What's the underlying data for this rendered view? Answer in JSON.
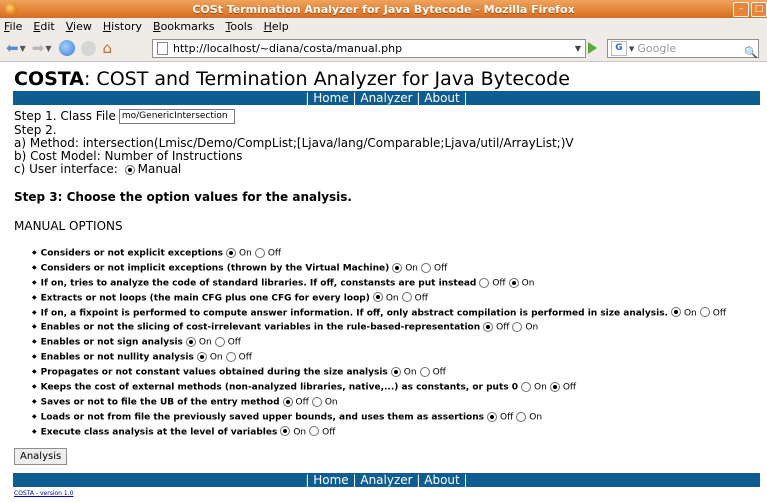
{
  "window": {
    "title": "COSt Termination Analyzer for Java Bytecode - Mozilla Firefox"
  },
  "menu": [
    "File",
    "Edit",
    "View",
    "History",
    "Bookmarks",
    "Tools",
    "Help"
  ],
  "nav": {
    "url": "http://localhost/~diana/costa/manual.php",
    "search_placeholder": "Google"
  },
  "page": {
    "title_bold": "COSTA",
    "title_rest": ": COST and Termination Analyzer for Java Bytecode",
    "navlinks": "| Home | Analyzer | About |",
    "step1_label": "Step 1. Class File",
    "class_file_value": "mo/GenericIntersection",
    "step2": "Step 2.",
    "method": "a) Method: intersection(Lmisc/Demo/CompList;[Ljava/lang/Comparable;Ljava/util/ArrayList;)V",
    "cost_model": "b) Cost Model: Number of Instructions",
    "ui_label": "c) User interface:",
    "ui_value": "Manual",
    "step3": "Step 3: Choose the option values for the analysis.",
    "manual_title": "MANUAL OPTIONS",
    "analysis_button": "Analysis",
    "version": "COSTA - version 1.0"
  },
  "options": [
    {
      "text": "Considers or not explicit exceptions",
      "a": "On",
      "b": "Off",
      "sel": "a"
    },
    {
      "text": "Considers or not implicit exceptions (thrown by the Virtual Machine)",
      "a": "On",
      "b": "Off",
      "sel": "a"
    },
    {
      "text": "If on, tries to analyze the code of standard libraries. If off, constansts are put instead",
      "a": "Off",
      "b": "On",
      "sel": "b"
    },
    {
      "text": "Extracts or not loops (the main CFG plus one CFG for every loop)",
      "a": "On",
      "b": "Off",
      "sel": "a"
    },
    {
      "text": "If on, a fixpoint is performed to compute answer information. If off, only abstract compilation is performed in size analysis.",
      "a": "On",
      "b": "Off",
      "sel": "a"
    },
    {
      "text": "Enables or not the slicing of cost-irrelevant variables in the rule-based-representation",
      "a": "Off",
      "b": "On",
      "sel": "a"
    },
    {
      "text": "Enables or not sign analysis",
      "a": "On",
      "b": "Off",
      "sel": "a"
    },
    {
      "text": "Enables or not nullity analysis",
      "a": "On",
      "b": "Off",
      "sel": "a"
    },
    {
      "text": "Propagates or not constant values obtained during the size analysis",
      "a": "On",
      "b": "Off",
      "sel": "a"
    },
    {
      "text": "Keeps the cost of external methods (non-analyzed libraries, native,...) as constants, or puts 0",
      "a": "On",
      "b": "Off",
      "sel": "b"
    },
    {
      "text": "Saves or not to file the UB of the entry method",
      "a": "Off",
      "b": "On",
      "sel": "a"
    },
    {
      "text": "Loads or not from file the previously saved upper bounds, and uses them as assertions",
      "a": "Off",
      "b": "On",
      "sel": "a"
    },
    {
      "text": "Execute class analysis at the level of variables",
      "a": "On",
      "b": "Off",
      "sel": "a"
    }
  ]
}
